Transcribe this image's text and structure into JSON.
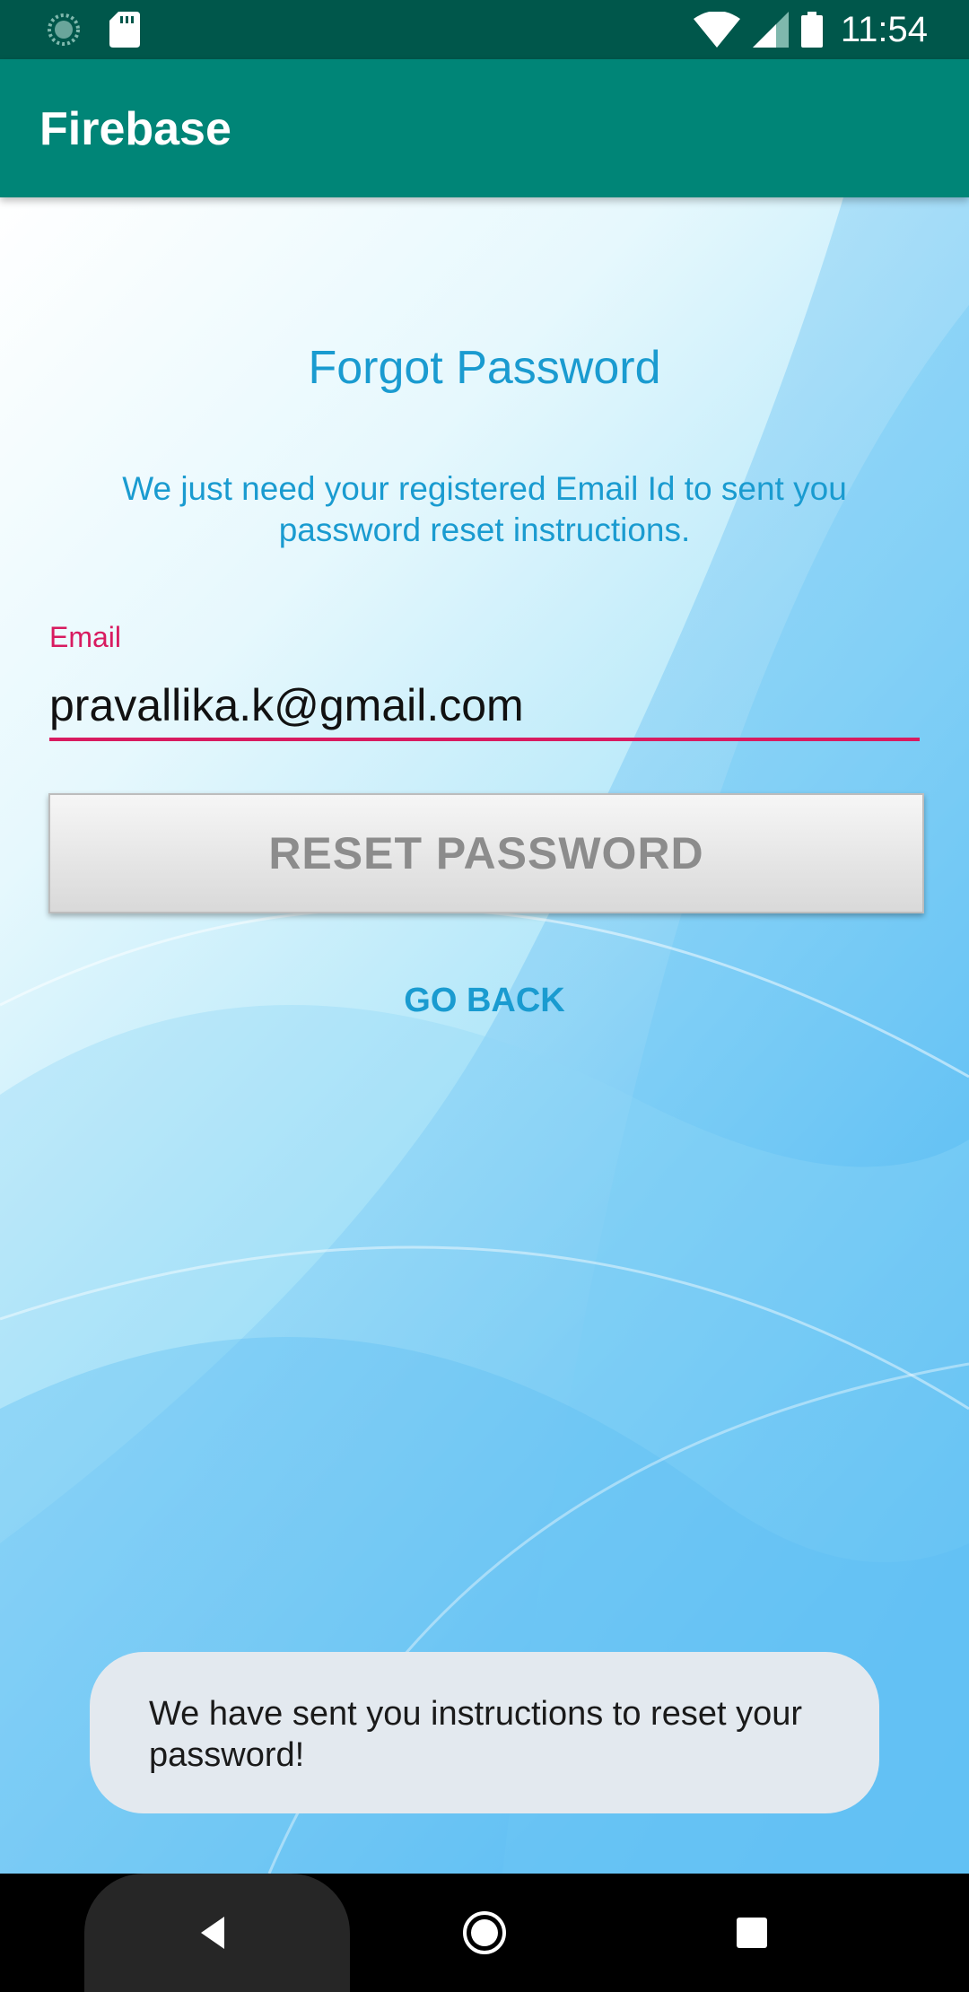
{
  "status_bar": {
    "time": "11:54",
    "icons": [
      "loading-icon",
      "sd-card-icon",
      "wifi-icon",
      "signal-icon",
      "battery-icon"
    ]
  },
  "app_bar": {
    "title": "Firebase",
    "color": "#008577"
  },
  "form": {
    "title": "Forgot Password",
    "subtitle": "We just need your registered Email Id to sent you password reset instructions.",
    "email_label": "Email",
    "email_value": "pravallika.k@gmail.com",
    "reset_button_label": "RESET PASSWORD",
    "go_back_label": "GO BACK"
  },
  "toast": {
    "message": "We have sent you instructions to reset your password!"
  },
  "nav_bar": {
    "icons": [
      "back-icon",
      "home-icon",
      "recent-apps-icon"
    ]
  },
  "colors": {
    "accent": "#d81b60",
    "text_blue": "#1a9bd0",
    "status_bar": "#00574b"
  }
}
